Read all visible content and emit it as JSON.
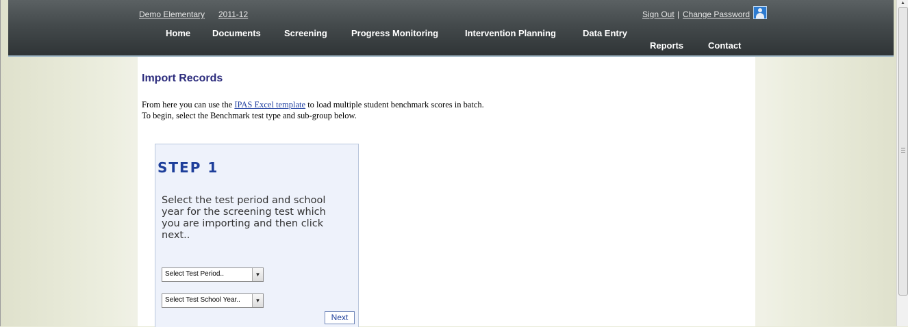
{
  "header": {
    "school": "Demo Elementary",
    "year": "2011-12",
    "sign_out": "Sign Out",
    "separator": "|",
    "change_password": "Change Password",
    "user_icon": "user-avatar-icon"
  },
  "nav": {
    "home": "Home",
    "documents": "Documents",
    "screening": "Screening",
    "progress_monitoring": "Progress Monitoring",
    "intervention_planning": "Intervention Planning",
    "data_entry": "Data Entry",
    "reports": "Reports",
    "contact": "Contact"
  },
  "main": {
    "title": "Import Records",
    "intro_before": "From here you can use the ",
    "intro_link": "IPAS Excel template",
    "intro_after": " to load multiple student benchmark scores in batch.",
    "intro_line2": "To begin, select the Benchmark test type and sub-group below."
  },
  "step": {
    "title": "STEP 1",
    "description": "Select the test period and school year for the screening test which you are importing and then click next..",
    "test_period": "Select Test Period..",
    "school_year": "Select Test School Year..",
    "next_label": "Next"
  },
  "colors": {
    "header_bg": "#444a4c",
    "title_color": "#2b2b7c",
    "step_title_color": "#1d3e9a",
    "step_bg": "#eef2fb"
  }
}
